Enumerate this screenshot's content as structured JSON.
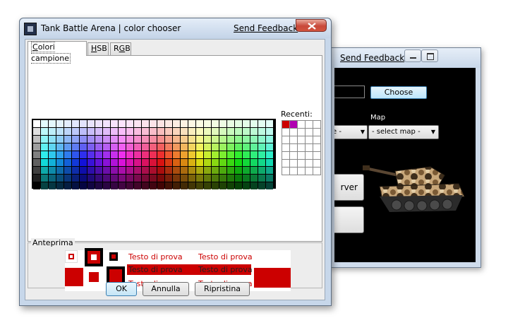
{
  "back_window": {
    "send_feedback": "Send Feedback",
    "choose_button": "Choose",
    "map_label": "Map",
    "left_combo_value": "e -",
    "map_select_value": "- select map -",
    "server_button_label": "rver"
  },
  "front_window": {
    "title": "Tank Battle Arena | color chooser",
    "send_feedback": "Send Feedback",
    "tabs": [
      {
        "label": "Colori campione",
        "mnemonic": "C",
        "rest": "olori campione"
      },
      {
        "label": "HSB",
        "mnemonic": "H",
        "rest": "SB"
      },
      {
        "label": "RGB",
        "mnemonic": "G",
        "pre": "R",
        "rest": "B"
      }
    ],
    "recent_label": "Recenti:",
    "recent_colors": [
      "#cc0000",
      "#b000b0"
    ],
    "preview_label": "Anteprima",
    "sample_text": "Testo di prova",
    "buttons": {
      "ok": "OK",
      "cancel": "Annulla",
      "reset": "Ripristina"
    },
    "selected_color": "#cc0000"
  }
}
